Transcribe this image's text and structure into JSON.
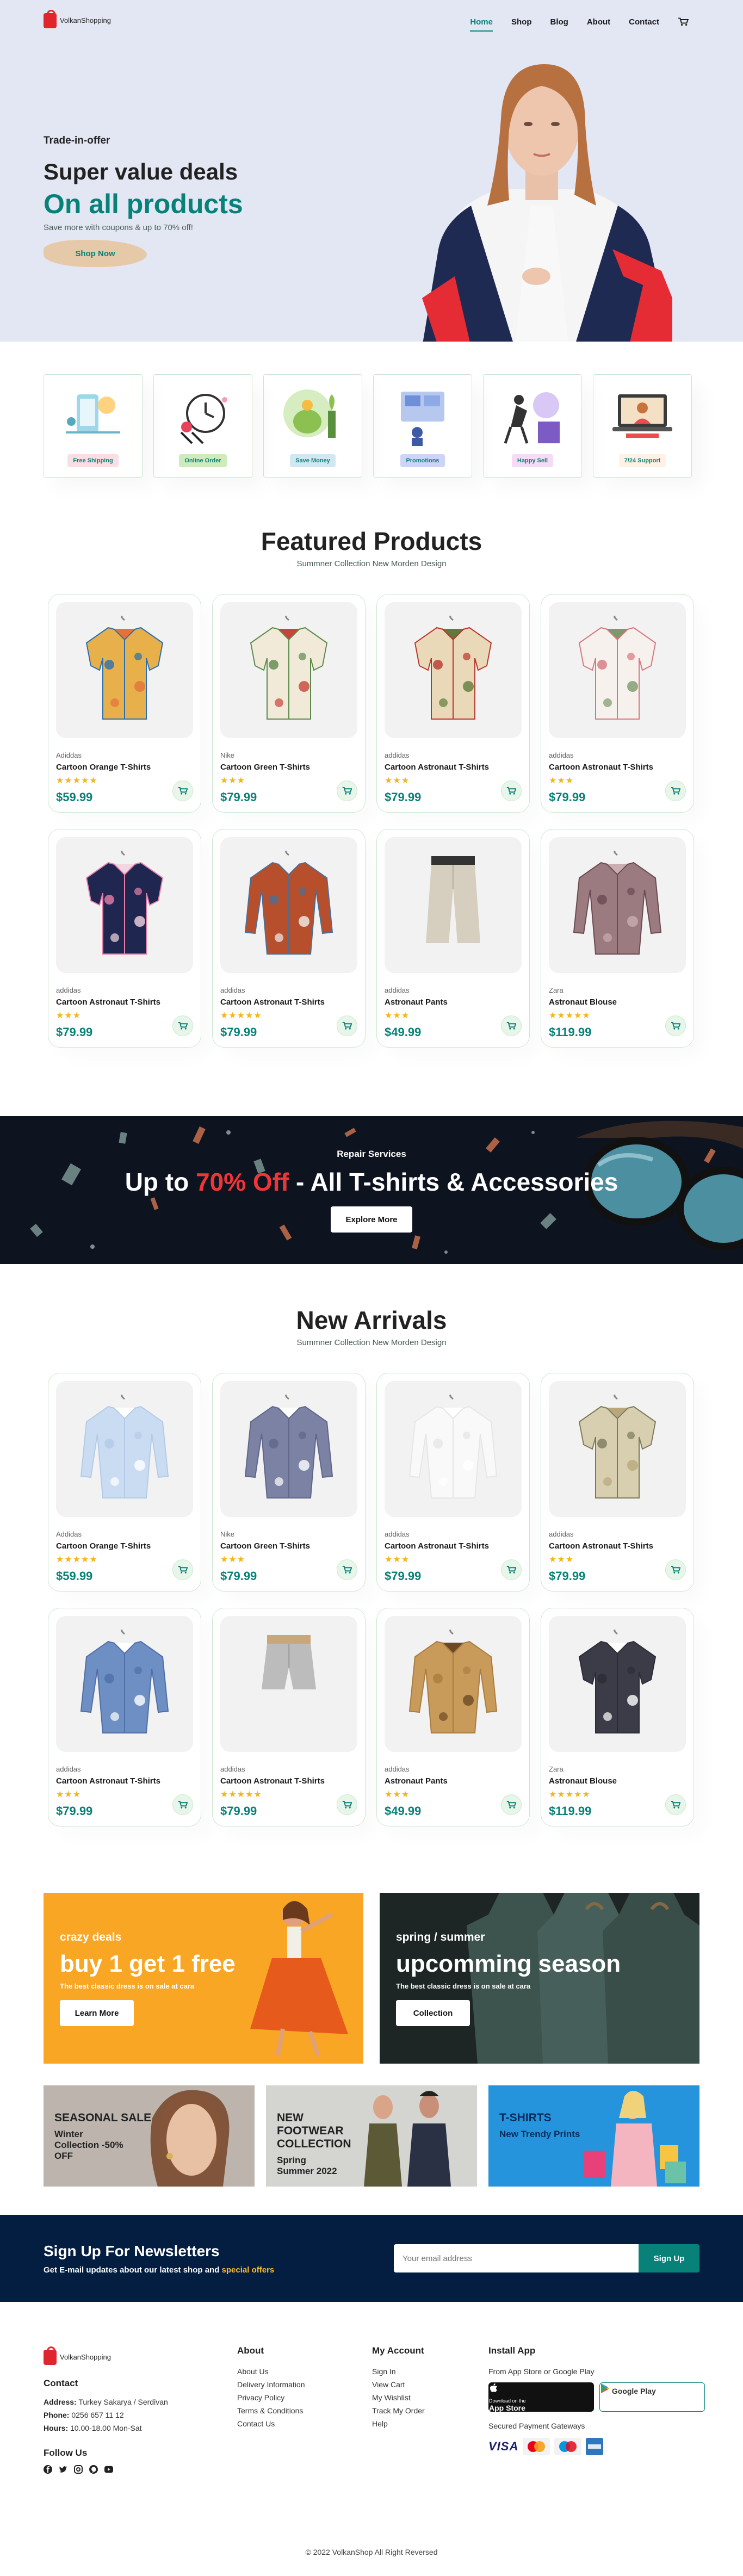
{
  "logo": {
    "line1": "VolkanShopping"
  },
  "nav": {
    "home": "Home",
    "shop": "Shop",
    "blog": "Blog",
    "about": "About",
    "contact": "Contact"
  },
  "hero": {
    "kicker": "Trade-in-offer",
    "title": "Super value deals",
    "highlight": "On all products",
    "subtitle": "Save more with coupons & up to 70% off!",
    "button": "Shop Now"
  },
  "features": [
    {
      "label": "Free Shipping",
      "color": "#fddde4"
    },
    {
      "label": "Online Order",
      "color": "#cdebbc"
    },
    {
      "label": "Save Money",
      "color": "#d1e8f2"
    },
    {
      "label": "Promotions",
      "color": "#cdd4f8"
    },
    {
      "label": "Happy Sell",
      "color": "#f6dbf6"
    },
    {
      "label": "7/24 Support",
      "color": "#fff2e5"
    }
  ],
  "featured": {
    "title": "Featured Products",
    "subtitle": "Summner Collection New Morden Design",
    "products": [
      {
        "brand": "Adiddas",
        "name": "Cartoon Orange T-Shirts",
        "stars": "★★★★★",
        "price": "$59.99",
        "icon": "floral-shirt-orange"
      },
      {
        "brand": "Nike",
        "name": "Cartoon Green T-Shirts",
        "stars": "★★★",
        "price": "$79.99",
        "icon": "floral-shirt-green"
      },
      {
        "brand": "addidas",
        "name": "Cartoon Astronaut T-Shirts",
        "stars": "★★★",
        "price": "$79.99",
        "icon": "floral-shirt-red"
      },
      {
        "brand": "addidas",
        "name": "Cartoon Astronaut T-Shirts",
        "stars": "★★★",
        "price": "$79.99",
        "icon": "floral-shirt-white"
      },
      {
        "brand": "addidas",
        "name": "Cartoon Astronaut T-Shirts",
        "stars": "★★★",
        "price": "$79.99",
        "icon": "floral-shirt-navy"
      },
      {
        "brand": "addidas",
        "name": "Cartoon Astronaut T-Shirts",
        "stars": "★★★★★",
        "price": "$79.99",
        "icon": "jacket-rust"
      },
      {
        "brand": "addidas",
        "name": "Astronaut Pants",
        "stars": "★★★",
        "price": "$49.99",
        "icon": "pants-khaki"
      },
      {
        "brand": "Zara",
        "name": "Astronaut Blouse",
        "stars": "★★★★★",
        "price": "$119.99",
        "icon": "blouse-mauve"
      }
    ]
  },
  "banner": {
    "kicker": "Repair Services",
    "title_pre": "Up to ",
    "title_highlight": "70% Off",
    "title_post": " - All T-shirts & Accessories",
    "button": "Explore More"
  },
  "arrivals": {
    "title": "New Arrivals",
    "subtitle": "Summner Collection New Morden Design",
    "products": [
      {
        "brand": "Addidas",
        "name": "Cartoon Orange T-Shirts",
        "stars": "★★★★★",
        "price": "$59.99",
        "icon": "shirt-lightblue"
      },
      {
        "brand": "Nike",
        "name": "Cartoon Green T-Shirts",
        "stars": "★★★",
        "price": "$79.99",
        "icon": "shirt-grey-blue"
      },
      {
        "brand": "addidas",
        "name": "Cartoon Astronaut T-Shirts",
        "stars": "★★★",
        "price": "$79.99",
        "icon": "shirt-white"
      },
      {
        "brand": "addidas",
        "name": "Cartoon Astronaut T-Shirts",
        "stars": "★★★",
        "price": "$79.99",
        "icon": "shirt-beige-print"
      },
      {
        "brand": "addidas",
        "name": "Cartoon Astronaut T-Shirts",
        "stars": "★★★",
        "price": "$79.99",
        "icon": "shirt-denim"
      },
      {
        "brand": "addidas",
        "name": "Cartoon Astronaut T-Shirts",
        "stars": "★★★★★",
        "price": "$79.99",
        "icon": "shorts-grey"
      },
      {
        "brand": "addidas",
        "name": "Astronaut Pants",
        "stars": "★★★",
        "price": "$49.99",
        "icon": "jacket-camel"
      },
      {
        "brand": "Zara",
        "name": "Astronaut Blouse",
        "stars": "★★★★★",
        "price": "$119.99",
        "icon": "shirt-charcoal"
      }
    ]
  },
  "promo1": {
    "kicker": "crazy deals",
    "title": "buy 1 get 1 free",
    "sub": "The best classic dress is on sale at cara",
    "button": "Learn More"
  },
  "promo2": {
    "kicker": "spring / summer",
    "title": "upcomming season",
    "sub": "The best classic dress is on sale at cara",
    "button": "Collection"
  },
  "promo3": [
    {
      "title": "SEASONAL SALE",
      "sub": "Winter Collection -50% OFF"
    },
    {
      "title": "NEW FOOTWEAR COLLECTION",
      "sub": "Spring Summer 2022"
    },
    {
      "title": "T-SHIRTS",
      "sub": "New Trendy Prints"
    }
  ],
  "newsletter": {
    "title": "Sign Up For Newsletters",
    "sub_pre": "Get E-mail updates about our latest shop and ",
    "sub_hl": "special offers",
    "placeholder": "Your email address",
    "button": "Sign Up"
  },
  "footer": {
    "contact_title": "Contact",
    "address_label": "Address:",
    "address": " Turkey Sakarya / Serdivan",
    "phone_label": "Phone:",
    "phone": " 0256 657 11 12",
    "hours_label": "Hours:",
    "hours": " 10.00-18.00 Mon-Sat",
    "follow": "Follow Us",
    "about_title": "About",
    "about_links": [
      "About Us",
      "Delivery Information",
      "Privacy Policy",
      "Terms & Conditions",
      "Contact Us"
    ],
    "account_title": "My Account",
    "account_links": [
      "Sign In",
      "View Cart",
      "My Wishlist",
      "Track My Order",
      "Help"
    ],
    "install_title": "Install App",
    "install_sub": "From App Store or Google Play",
    "appstore_small": "Download on the",
    "appstore": "App Store",
    "googleplay": "Google Play",
    "payment_title": "Secured Payment Gateways",
    "visa": "VISA",
    "copyright": "© 2022 VolkanShop All Right Reversed"
  },
  "colors": {
    "accent": "#088178",
    "hero_bg": "#e3e6f3",
    "newsletter_bg": "#041e42",
    "promo_orange": "#f8a623",
    "banner_red": "#ef3636"
  }
}
